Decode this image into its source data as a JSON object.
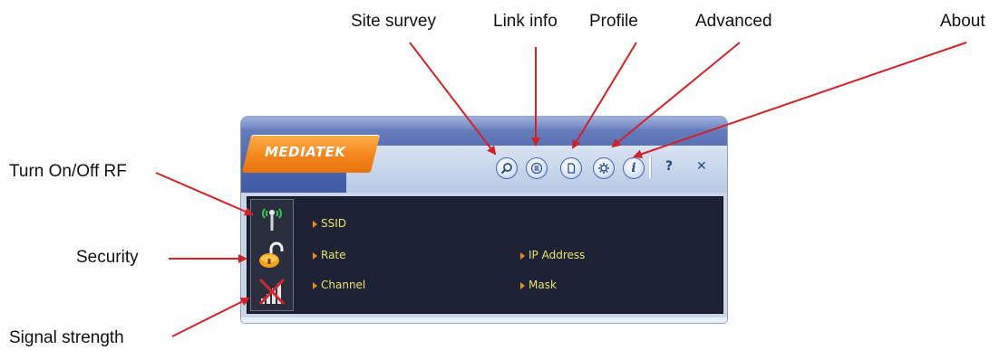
{
  "callouts": {
    "site_survey": "Site survey",
    "link_info": "Link info",
    "profile": "Profile",
    "advanced": "Advanced",
    "about": "About",
    "turn_on_off_rf": "Turn On/Off RF",
    "security": "Security",
    "signal_strength": "Signal strength"
  },
  "window": {
    "brand": "MEDIATEK",
    "toolbar": {
      "site_survey_icon": "magnifier-icon",
      "link_info_icon": "list-icon",
      "profile_icon": "page-icon",
      "advanced_icon": "gear-icon",
      "about_icon": "info-icon",
      "about_glyph": "i",
      "help_label": "?",
      "close_label": "✕"
    },
    "status": {
      "rf_icon": "antenna-icon",
      "security_icon": "unlocked-padlock-icon",
      "signal_icon": "signal-bars-disconnected-icon"
    },
    "fields": {
      "ssid": "SSID",
      "rate": "Rate",
      "channel": "Channel",
      "ip_address": "IP Address",
      "mask": "Mask"
    }
  },
  "colors": {
    "arrow": "#d42027",
    "brand_orange": "#f4861c",
    "panel_bg": "#1d2235",
    "field_text": "#e7e36b"
  }
}
